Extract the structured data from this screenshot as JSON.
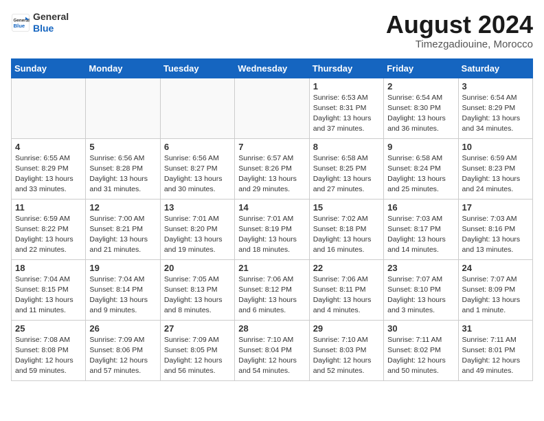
{
  "header": {
    "logo_line1": "General",
    "logo_line2": "Blue",
    "title": "August 2024",
    "subtitle": "Timezgadiouine, Morocco"
  },
  "calendar": {
    "headers": [
      "Sunday",
      "Monday",
      "Tuesday",
      "Wednesday",
      "Thursday",
      "Friday",
      "Saturday"
    ],
    "rows": [
      [
        {
          "day": "",
          "info": ""
        },
        {
          "day": "",
          "info": ""
        },
        {
          "day": "",
          "info": ""
        },
        {
          "day": "",
          "info": ""
        },
        {
          "day": "1",
          "info": "Sunrise: 6:53 AM\nSunset: 8:31 PM\nDaylight: 13 hours\nand 37 minutes."
        },
        {
          "day": "2",
          "info": "Sunrise: 6:54 AM\nSunset: 8:30 PM\nDaylight: 13 hours\nand 36 minutes."
        },
        {
          "day": "3",
          "info": "Sunrise: 6:54 AM\nSunset: 8:29 PM\nDaylight: 13 hours\nand 34 minutes."
        }
      ],
      [
        {
          "day": "4",
          "info": "Sunrise: 6:55 AM\nSunset: 8:29 PM\nDaylight: 13 hours\nand 33 minutes."
        },
        {
          "day": "5",
          "info": "Sunrise: 6:56 AM\nSunset: 8:28 PM\nDaylight: 13 hours\nand 31 minutes."
        },
        {
          "day": "6",
          "info": "Sunrise: 6:56 AM\nSunset: 8:27 PM\nDaylight: 13 hours\nand 30 minutes."
        },
        {
          "day": "7",
          "info": "Sunrise: 6:57 AM\nSunset: 8:26 PM\nDaylight: 13 hours\nand 29 minutes."
        },
        {
          "day": "8",
          "info": "Sunrise: 6:58 AM\nSunset: 8:25 PM\nDaylight: 13 hours\nand 27 minutes."
        },
        {
          "day": "9",
          "info": "Sunrise: 6:58 AM\nSunset: 8:24 PM\nDaylight: 13 hours\nand 25 minutes."
        },
        {
          "day": "10",
          "info": "Sunrise: 6:59 AM\nSunset: 8:23 PM\nDaylight: 13 hours\nand 24 minutes."
        }
      ],
      [
        {
          "day": "11",
          "info": "Sunrise: 6:59 AM\nSunset: 8:22 PM\nDaylight: 13 hours\nand 22 minutes."
        },
        {
          "day": "12",
          "info": "Sunrise: 7:00 AM\nSunset: 8:21 PM\nDaylight: 13 hours\nand 21 minutes."
        },
        {
          "day": "13",
          "info": "Sunrise: 7:01 AM\nSunset: 8:20 PM\nDaylight: 13 hours\nand 19 minutes."
        },
        {
          "day": "14",
          "info": "Sunrise: 7:01 AM\nSunset: 8:19 PM\nDaylight: 13 hours\nand 18 minutes."
        },
        {
          "day": "15",
          "info": "Sunrise: 7:02 AM\nSunset: 8:18 PM\nDaylight: 13 hours\nand 16 minutes."
        },
        {
          "day": "16",
          "info": "Sunrise: 7:03 AM\nSunset: 8:17 PM\nDaylight: 13 hours\nand 14 minutes."
        },
        {
          "day": "17",
          "info": "Sunrise: 7:03 AM\nSunset: 8:16 PM\nDaylight: 13 hours\nand 13 minutes."
        }
      ],
      [
        {
          "day": "18",
          "info": "Sunrise: 7:04 AM\nSunset: 8:15 PM\nDaylight: 13 hours\nand 11 minutes."
        },
        {
          "day": "19",
          "info": "Sunrise: 7:04 AM\nSunset: 8:14 PM\nDaylight: 13 hours\nand 9 minutes."
        },
        {
          "day": "20",
          "info": "Sunrise: 7:05 AM\nSunset: 8:13 PM\nDaylight: 13 hours\nand 8 minutes."
        },
        {
          "day": "21",
          "info": "Sunrise: 7:06 AM\nSunset: 8:12 PM\nDaylight: 13 hours\nand 6 minutes."
        },
        {
          "day": "22",
          "info": "Sunrise: 7:06 AM\nSunset: 8:11 PM\nDaylight: 13 hours\nand 4 minutes."
        },
        {
          "day": "23",
          "info": "Sunrise: 7:07 AM\nSunset: 8:10 PM\nDaylight: 13 hours\nand 3 minutes."
        },
        {
          "day": "24",
          "info": "Sunrise: 7:07 AM\nSunset: 8:09 PM\nDaylight: 13 hours\nand 1 minute."
        }
      ],
      [
        {
          "day": "25",
          "info": "Sunrise: 7:08 AM\nSunset: 8:08 PM\nDaylight: 12 hours\nand 59 minutes."
        },
        {
          "day": "26",
          "info": "Sunrise: 7:09 AM\nSunset: 8:06 PM\nDaylight: 12 hours\nand 57 minutes."
        },
        {
          "day": "27",
          "info": "Sunrise: 7:09 AM\nSunset: 8:05 PM\nDaylight: 12 hours\nand 56 minutes."
        },
        {
          "day": "28",
          "info": "Sunrise: 7:10 AM\nSunset: 8:04 PM\nDaylight: 12 hours\nand 54 minutes."
        },
        {
          "day": "29",
          "info": "Sunrise: 7:10 AM\nSunset: 8:03 PM\nDaylight: 12 hours\nand 52 minutes."
        },
        {
          "day": "30",
          "info": "Sunrise: 7:11 AM\nSunset: 8:02 PM\nDaylight: 12 hours\nand 50 minutes."
        },
        {
          "day": "31",
          "info": "Sunrise: 7:11 AM\nSunset: 8:01 PM\nDaylight: 12 hours\nand 49 minutes."
        }
      ]
    ]
  }
}
